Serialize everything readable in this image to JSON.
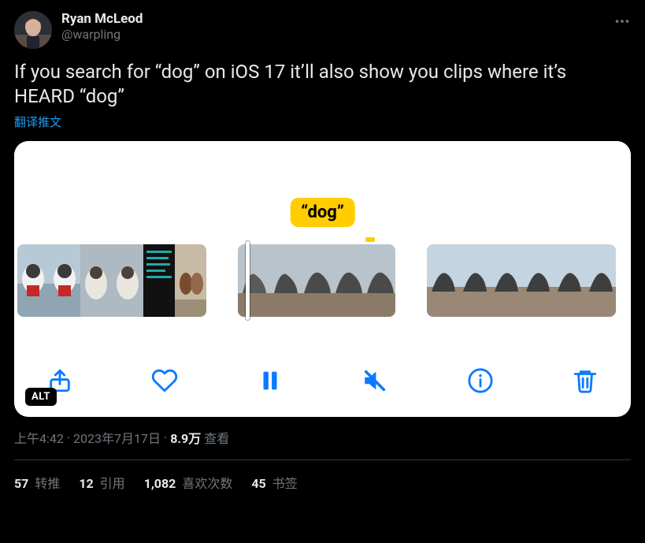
{
  "author": {
    "display_name": "Ryan McLeod",
    "handle": "@warpling"
  },
  "tweet_text": "If you search for “dog” on iOS 17 it’ll also show you clips where it’s HEARD “dog”",
  "translate_label": "翻译推文",
  "media": {
    "bubble_text": "“dog”",
    "alt_badge": "ALT"
  },
  "meta": {
    "time": "上午4:42",
    "dot1": " · ",
    "date": "2023年7月17日",
    "dot2": " · ",
    "views_count": "8.9万",
    "views_label": " 查看"
  },
  "stats": {
    "retweets_count": "57",
    "retweets_label": " 转推",
    "quotes_count": "12",
    "quotes_label": " 引用",
    "likes_count": "1,082",
    "likes_label": " 喜欢次数",
    "bookmarks_count": "45",
    "bookmarks_label": " 书签"
  }
}
